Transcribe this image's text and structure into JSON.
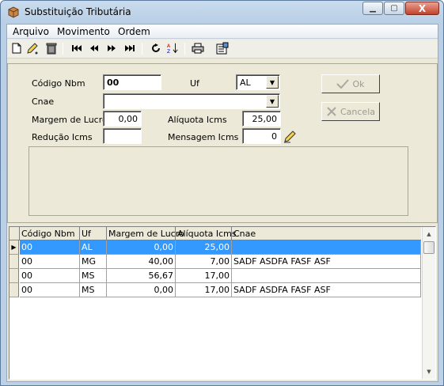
{
  "window": {
    "title": "Substituição Tributária",
    "min": "▭",
    "max": "▢",
    "close": "X"
  },
  "menu": [
    "Arquivo",
    "Movimento",
    "Ordem"
  ],
  "toolbar": {
    "icons": [
      "new-document-icon",
      "edit-pencil-icon",
      "trash-icon",
      "first-record-icon",
      "prior-record-icon",
      "next-record-icon",
      "last-record-icon",
      "refresh-icon",
      "sort-az-icon",
      "print-icon",
      "properties-icon"
    ],
    "glyphs": {
      "new": "🗋",
      "edit": "✎",
      "trash": "🗑",
      "first": "⏮",
      "prior": "⏪",
      "next": "⏩",
      "last": "⏭",
      "refresh": "⟳",
      "sort": "A↓",
      "print": "🖶",
      "props": "▤"
    }
  },
  "form": {
    "codigo_label": "Código Nbm",
    "codigo_value": "00",
    "uf_label": "Uf",
    "uf_value": "AL",
    "cnae_label": "Cnae",
    "cnae_value": "",
    "margem_label": "Margem de Lucro",
    "margem_value": "0,00",
    "aliquota_label": "Alíquota Icms",
    "aliquota_value": "25,00",
    "reducao_label": "Redução Icms",
    "reducao_value": "",
    "mensagem_label": "Mensagem Icms",
    "mensagem_value": "0",
    "ok_label": "Ok",
    "cancel_label": "Cancela"
  },
  "grid": {
    "columns": [
      "Código Nbm",
      "Uf",
      "Margem de Lucro",
      "Alíquota Icms",
      "Cnae"
    ],
    "rows": [
      {
        "codigo": "00",
        "uf": "AL",
        "margem": "0,00",
        "aliquota": "25,00",
        "cnae": ""
      },
      {
        "codigo": "00",
        "uf": "MG",
        "margem": "40,00",
        "aliquota": "7,00",
        "cnae": "SADF ASDFA FASF ASF"
      },
      {
        "codigo": "00",
        "uf": "MS",
        "margem": "56,67",
        "aliquota": "17,00",
        "cnae": ""
      },
      {
        "codigo": "00",
        "uf": "MS",
        "margem": "0,00",
        "aliquota": "17,00",
        "cnae": "SADF ASDFA FASF ASF"
      }
    ],
    "selected_row": 0
  },
  "colors": {
    "selection": "#3399ff",
    "titlebar": "#c9dbee"
  }
}
